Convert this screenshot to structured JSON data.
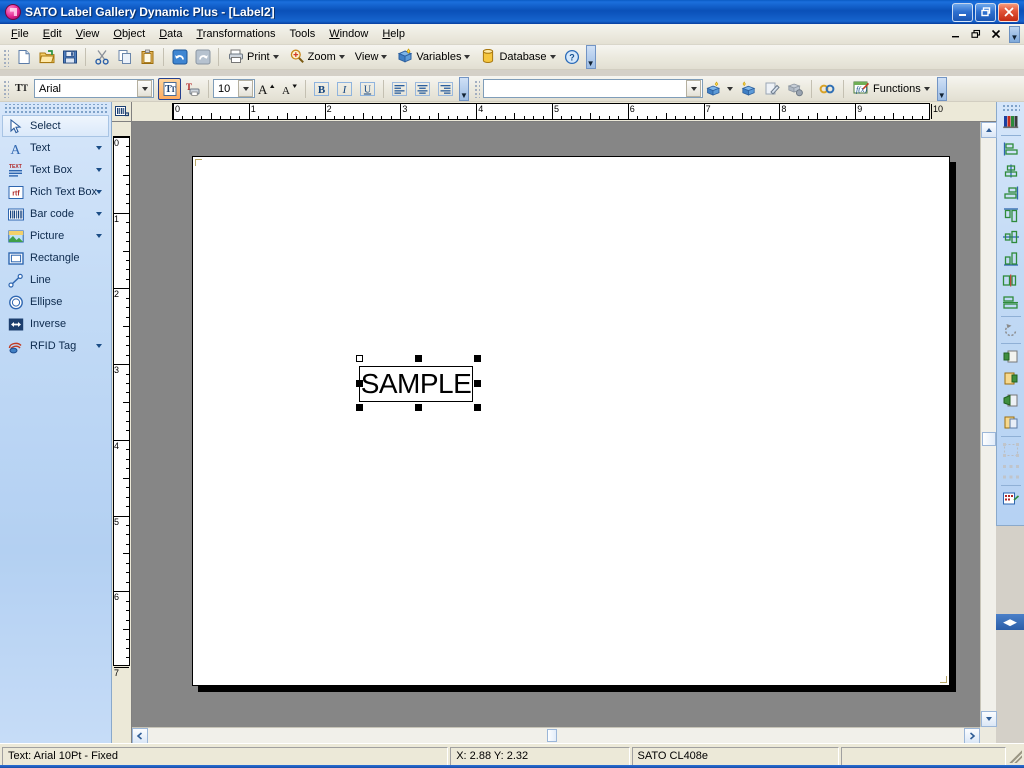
{
  "window": {
    "title": "SATO Label Gallery Dynamic Plus  - [Label2]",
    "app_name": "SATO Label Gallery Dynamic Plus",
    "document_name": "Label2",
    "icon": "sato-app-icon",
    "buttons": {
      "minimize": "minimize-icon",
      "restore": "restore-icon",
      "close": "close-icon"
    },
    "mdi_buttons": {
      "minimize": "_",
      "restore": "restore-glyph",
      "close": "×"
    }
  },
  "menu": {
    "items": [
      {
        "label": "File",
        "accel": "F"
      },
      {
        "label": "Edit",
        "accel": "E"
      },
      {
        "label": "View",
        "accel": "V"
      },
      {
        "label": "Object",
        "accel": "O"
      },
      {
        "label": "Data",
        "accel": "D"
      },
      {
        "label": "Transformations",
        "accel": "T"
      },
      {
        "label": "Tools",
        "accel": "T"
      },
      {
        "label": "Window",
        "accel": "W"
      },
      {
        "label": "Help",
        "accel": "H"
      }
    ]
  },
  "standard_toolbar": {
    "buttons": [
      {
        "name": "new-icon",
        "tooltip": "New"
      },
      {
        "name": "open-icon",
        "tooltip": "Open"
      },
      {
        "name": "save-icon",
        "tooltip": "Save"
      },
      {
        "name": "cut-icon",
        "tooltip": "Cut"
      },
      {
        "name": "copy-icon",
        "tooltip": "Copy"
      },
      {
        "name": "paste-icon",
        "tooltip": "Paste"
      },
      {
        "name": "undo-icon",
        "tooltip": "Undo"
      },
      {
        "name": "redo-icon",
        "tooltip": "Redo"
      }
    ],
    "dropdowns": [
      {
        "label": "Print",
        "icon": "printer-icon"
      },
      {
        "label": "Zoom",
        "icon": "magnifier-icon"
      },
      {
        "label": "View",
        "icon": "view-icon"
      },
      {
        "label": "Variables",
        "icon": "variables-cube-icon"
      },
      {
        "label": "Database",
        "icon": "database-icon"
      }
    ],
    "help_button": {
      "label": "?",
      "name": "help-icon"
    },
    "overflow": "toolbar-overflow-chevron"
  },
  "format_toolbar": {
    "font_name": "Arial",
    "font_name_placeholder": "Arial",
    "font_size": "10",
    "font_icon": "font-select-icon",
    "buttons": [
      {
        "name": "font-toggle-icon",
        "label": "T",
        "active": true
      },
      {
        "name": "printer-font-icon",
        "label": "T",
        "active": false
      },
      {
        "name": "increase-font-icon",
        "label": "A",
        "active": false
      },
      {
        "name": "decrease-font-icon",
        "label": "A",
        "active": false
      },
      {
        "name": "bold-icon",
        "label": "B",
        "active": false
      },
      {
        "name": "italic-icon",
        "label": "I",
        "active": false
      },
      {
        "name": "underline-icon",
        "label": "U",
        "active": false
      },
      {
        "name": "align-left-icon",
        "label": "",
        "active": false
      },
      {
        "name": "align-center-icon",
        "label": "",
        "active": false
      },
      {
        "name": "align-right-icon",
        "label": "",
        "active": false
      }
    ],
    "variable_field_value": "",
    "variable_field_placeholder": "",
    "right_buttons": [
      {
        "name": "new-variable-wizard-icon"
      },
      {
        "name": "new-variable-icon"
      },
      {
        "name": "edit-variable-icon"
      },
      {
        "name": "delete-variable-icon"
      },
      {
        "name": "link-variable-icon"
      }
    ],
    "functions_label": "Functions",
    "functions_icon": "functions-icon"
  },
  "toolbox": {
    "items": [
      {
        "label": "Select",
        "icon": "cursor-arrow-icon",
        "has_dropdown": false,
        "selected": true
      },
      {
        "label": "Text",
        "icon": "text-a-icon",
        "has_dropdown": true,
        "selected": false
      },
      {
        "label": "Text Box",
        "icon": "text-box-icon",
        "has_dropdown": true,
        "selected": false
      },
      {
        "label": "Rich Text Box",
        "icon": "rtf-icon",
        "has_dropdown": true,
        "selected": false
      },
      {
        "label": "Bar code",
        "icon": "barcode-icon",
        "has_dropdown": true,
        "selected": false
      },
      {
        "label": "Picture",
        "icon": "picture-icon",
        "has_dropdown": true,
        "selected": false
      },
      {
        "label": "Rectangle",
        "icon": "rectangle-icon",
        "has_dropdown": false,
        "selected": false
      },
      {
        "label": "Line",
        "icon": "line-icon",
        "has_dropdown": false,
        "selected": false
      },
      {
        "label": "Ellipse",
        "icon": "ellipse-icon",
        "has_dropdown": false,
        "selected": false
      },
      {
        "label": "Inverse",
        "icon": "inverse-icon",
        "has_dropdown": false,
        "selected": false
      },
      {
        "label": "RFID Tag",
        "icon": "rfid-tag-icon",
        "has_dropdown": true,
        "selected": false
      }
    ]
  },
  "align_toolbar": {
    "buttons": [
      {
        "name": "color-palette-icon"
      },
      {
        "name": "align-left-objects-icon"
      },
      {
        "name": "align-center-objects-icon"
      },
      {
        "name": "align-right-objects-icon"
      },
      {
        "name": "align-top-objects-icon"
      },
      {
        "name": "align-middle-objects-icon"
      },
      {
        "name": "align-bottom-objects-icon"
      },
      {
        "name": "distribute-horizontal-icon"
      },
      {
        "name": "distribute-vertical-icon"
      },
      {
        "name": "rotate-icon"
      },
      {
        "name": "bring-to-front-icon"
      },
      {
        "name": "send-to-back-icon"
      },
      {
        "name": "bring-forward-icon"
      },
      {
        "name": "send-backward-icon"
      },
      {
        "name": "group-objects-icon"
      },
      {
        "name": "ungroup-objects-icon"
      },
      {
        "name": "object-properties-icon"
      }
    ],
    "collapse": "collapse-toolbar-icon"
  },
  "rulers": {
    "unit": "inch",
    "horizontal_ticks": [
      0,
      1,
      2,
      3,
      4,
      5,
      6,
      7,
      8,
      9,
      10
    ],
    "vertical_ticks": [
      0,
      1,
      2,
      3,
      4,
      5,
      6,
      7
    ]
  },
  "canvas": {
    "objects": [
      {
        "type": "text",
        "value": "SAMPLE",
        "selected": true,
        "font": "Arial",
        "size_pt": "10"
      }
    ]
  },
  "scrollbars": {
    "vertical": {
      "up": "scroll-up-arrow",
      "down": "scroll-down-arrow"
    },
    "horizontal": {
      "left": "scroll-left-arrow",
      "right": "scroll-right-arrow"
    }
  },
  "statusbar": {
    "object_info": "Text: Arial 10Pt - Fixed",
    "coordinates": "X:  2.88 Y:  2.32",
    "printer": "SATO CL408e",
    "extra": ""
  }
}
